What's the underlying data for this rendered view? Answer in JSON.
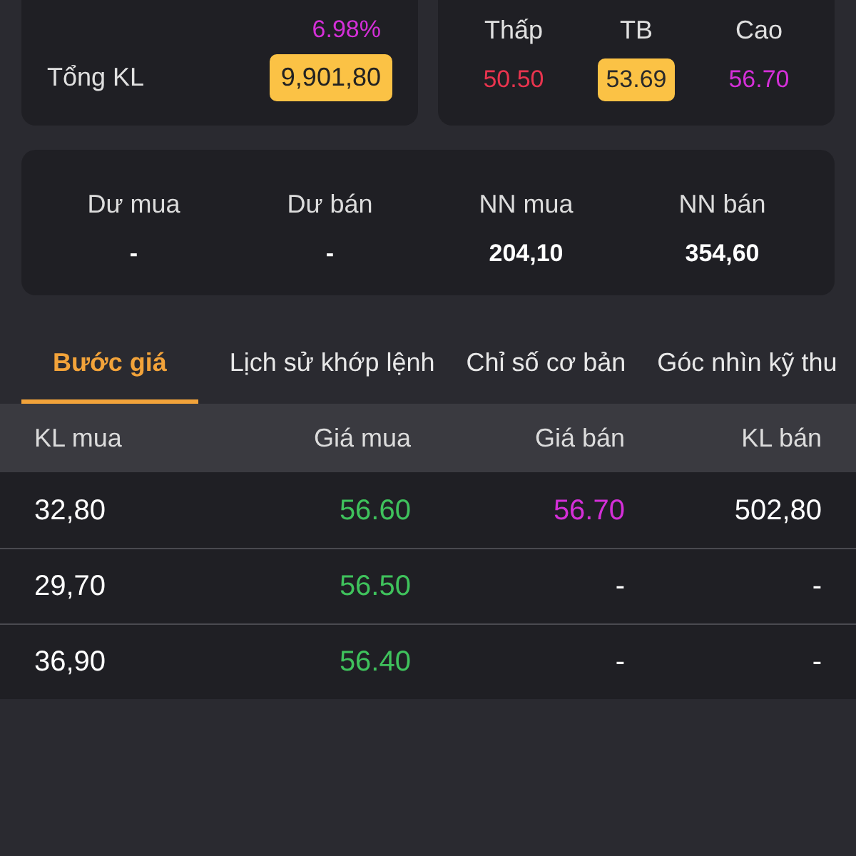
{
  "quote": {
    "change_pct": "6.98%",
    "total_label": "Tổng KL",
    "total_value": "9,901,80"
  },
  "range": [
    {
      "label": "Thấp",
      "value": "50.50",
      "color": "#e8344e",
      "highlighted": false
    },
    {
      "label": "TB",
      "value": "53.69",
      "color": "#fbc245",
      "highlighted": true
    },
    {
      "label": "Cao",
      "value": "56.70",
      "color": "#d42fd8",
      "highlighted": false
    }
  ],
  "stats": [
    {
      "label": "Dư mua",
      "value": "-"
    },
    {
      "label": "Dư bán",
      "value": "-"
    },
    {
      "label": "NN mua",
      "value": "204,10"
    },
    {
      "label": "NN bán",
      "value": "354,60"
    }
  ],
  "tabs": [
    {
      "label": "Bước giá",
      "selected": true
    },
    {
      "label": "Lịch sử khớp lệnh",
      "selected": false
    },
    {
      "label": "Chỉ số cơ bản",
      "selected": false
    },
    {
      "label": "Góc nhìn kỹ thu",
      "selected": false
    }
  ],
  "table": {
    "columns": [
      "KL mua",
      "Giá mua",
      "Giá bán",
      "KL bán"
    ],
    "rows": [
      [
        {
          "text": "32,80",
          "color": "#ffffff"
        },
        {
          "text": "56.60",
          "color": "#3fc25c"
        },
        {
          "text": "56.70",
          "color": "#d42fd8"
        },
        {
          "text": "502,80",
          "color": "#ffffff"
        }
      ],
      [
        {
          "text": "29,70",
          "color": "#ffffff"
        },
        {
          "text": "56.50",
          "color": "#3fc25c"
        },
        {
          "text": "-",
          "color": "#ffffff"
        },
        {
          "text": "-",
          "color": "#ffffff"
        }
      ],
      [
        {
          "text": "36,90",
          "color": "#ffffff"
        },
        {
          "text": "56.40",
          "color": "#3fc25c"
        },
        {
          "text": "-",
          "color": "#ffffff"
        },
        {
          "text": "-",
          "color": "#ffffff"
        }
      ]
    ]
  }
}
